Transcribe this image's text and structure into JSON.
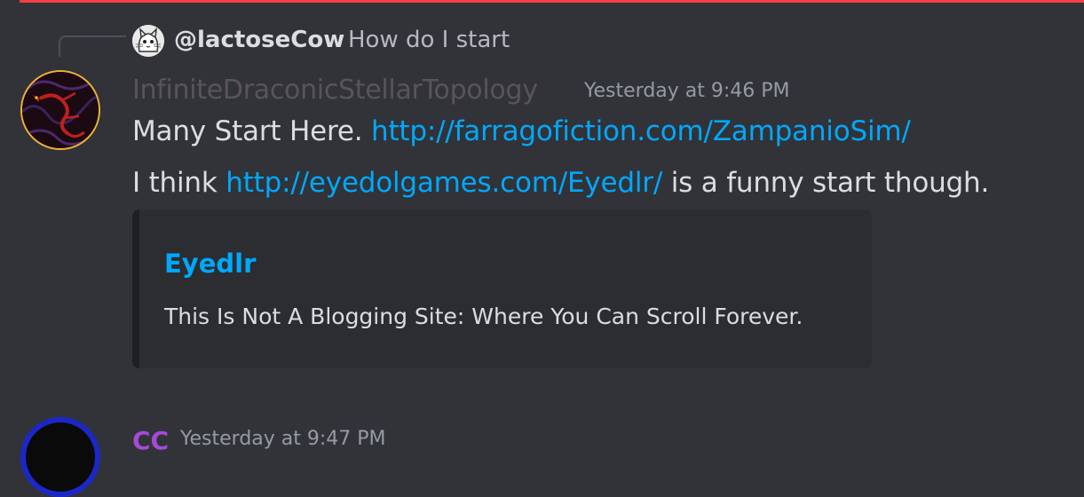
{
  "accent_colors": {
    "link": "#00a8fc",
    "alert_bar": "#f23f43",
    "avatar_ring": "#f0b232",
    "next_avatar_ring": "#1c27c9",
    "next_username": "#a54bd5"
  },
  "reply": {
    "avatar_icon": "cat-avatar-icon",
    "username": "@lactoseCow",
    "text": "How do I start"
  },
  "message": {
    "avatar_icon": "dragon-avatar-icon",
    "username": "InfiniteDraconicStellarTopology",
    "timestamp": "Yesterday at 9:46 PM",
    "line1": {
      "prefix": "Many Start Here. ",
      "link": "http://farragofiction.com/ZampanioSim/"
    },
    "line2": {
      "prefix": "I think ",
      "link": "http://eyedolgames.com/Eyedlr/",
      "suffix": " is a funny start though."
    },
    "embed": {
      "title": "Eyedlr",
      "description": "This Is Not A Blogging Site: Where You Can Scroll Forever."
    }
  },
  "next_message": {
    "avatar_icon": "user-avatar-icon",
    "username": "CC",
    "timestamp": "Yesterday at 9:47 PM"
  }
}
